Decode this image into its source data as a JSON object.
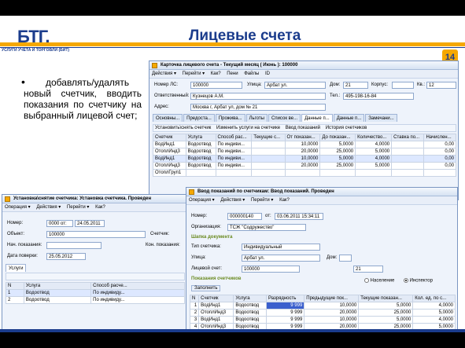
{
  "slide": {
    "title": "Лицевые счета",
    "logo_text": "БТГ.",
    "logo_caption": "УСЛУГИ УЧЕТА И ТОРГОВЛИ (БИТ)",
    "page_number": "14",
    "bullet_text": "добавлять/удалять новый счетчик, вводить показания по счетчику на выбранный лицевой счет;"
  },
  "win1": {
    "title": "Карточка лицевого счета - Текущий месяц ( Июнь ): 100000",
    "toolbar": [
      "Действия ▾",
      "Перейти ▾",
      "Как?",
      "Пени",
      "Файлы",
      "ID"
    ],
    "fields": {
      "nomer_label": "Номер ЛС:",
      "nomer_value": "100000",
      "street_label": "Улица:",
      "street_value": "Арбат ул.",
      "house_label": "Дом:",
      "house_value": "21",
      "korpus_label": "Корпус:",
      "kv_label": "Кв.:",
      "kv_value": "12",
      "otv_label": "Ответственный:",
      "otv_value": "Кузнецов А.М.",
      "tel_label": "Тел.:",
      "tel_value": "495-198-16-84",
      "addr_label": "Адрес:",
      "addr_value": "Москва г, Арбат ул, дом № 21"
    },
    "tabs": [
      "Основны...",
      "Предоста...",
      "Прожива...",
      "Льготы",
      "Список ве...",
      "Данные п...",
      "Данные п...",
      "Замечани..."
    ],
    "subtoolbar": [
      "Установить\\снять счетчик",
      "Изменить услуги на счетчике",
      "Ввод показаний",
      "История счетчиков"
    ],
    "columns": [
      "Счетчик",
      "Услуга",
      "Способ рас...",
      "Текущие с...",
      "От показан...",
      "До показан...",
      "Количество...",
      "Ставка по...",
      "Начислен..."
    ],
    "rows": [
      [
        "ВодИнд1",
        "Водоотвод",
        "По индиви...",
        "",
        "10,0000",
        "5,0000",
        "4,0000",
        "",
        "0,00"
      ],
      [
        "ОтоплИнд3",
        "Водоотвод",
        "По индиви...",
        "",
        "20,0000",
        "25,0000",
        "5,0000",
        "",
        "0,00"
      ],
      [
        "ВодИнд1",
        "Водоотвод",
        "По индиви...",
        "",
        "10,0000",
        "5,0000",
        "4,0000",
        "",
        "0,00"
      ],
      [
        "ОтоплИнд3",
        "Водоотвод",
        "По индиви...",
        "",
        "20,0000",
        "25,0000",
        "5,0000",
        "",
        "0,00"
      ],
      [
        "ОтоплГруп1",
        "",
        "",
        "",
        "",
        "",
        "",
        "",
        ""
      ]
    ]
  },
  "win2": {
    "title": "Установка\\снятие счетчика: Установка счетчика. Проведен",
    "toolbar": [
      "Операция ▾",
      "Действия ▾",
      "Перейти ▾",
      "Как?"
    ],
    "fields": {
      "nomer_label": "Номер:",
      "nomer_value": "0000 от:",
      "date_value": "24.05.2011",
      "object_label": "Объект:",
      "object_value": "100000",
      "schetchik_label": "Счетчик:",
      "nach_label": "Нач. показания:",
      "kon_label": "Кон. показания:",
      "poverka_label": "Дата поверки:",
      "poverka_value": "25.05.2012"
    },
    "tab": "Услуги",
    "columns": [
      "N",
      "Услуга",
      "Способ расче..."
    ],
    "rows": [
      [
        "1",
        "Водоотвод",
        "По индивиду..."
      ],
      [
        "2",
        "Водоотвод",
        "По индивиду..."
      ]
    ]
  },
  "win3": {
    "title": "Ввод показаний по счетчикам: Ввод показаний. Проведен",
    "toolbar": [
      "Операция ▾",
      "Действия ▾",
      "Перейти ▾",
      "Как?"
    ],
    "fields": {
      "nomer_label": "Номер:",
      "nomer_value": "000000140",
      "ot_label": "от:",
      "date_value": "03.06.2011 15:34:11",
      "org_label": "Организация:",
      "org_value": "ТСЖ \"Содружество\""
    },
    "section1": "Шапка документа",
    "fields2": {
      "tip_label": "Тип счетчика:",
      "tip_value": "Индивидуальный",
      "street_label": "Улица:",
      "street_value": "Арбат ул.",
      "dom_label": "Дом:",
      "dom_value": "21",
      "ls_label": "Лицевой счет:",
      "ls_value": "100000",
      "naselenie_label": "Население",
      "inspektor_label": "Инспектор"
    },
    "section2": "Показания счетчиков",
    "fill_button": "Заполнить",
    "columns": [
      "N",
      "Счетчик",
      "Услуга",
      "Разрядность",
      "Предыдущие пок...",
      "Текущие показан...",
      "Кол. ед. по с..."
    ],
    "rows": [
      [
        "1",
        "ВодИнд1",
        "Водоотвод",
        "9 999",
        "10,0000",
        "5,0000",
        "4,0000"
      ],
      [
        "2",
        "ОтоплИнд3",
        "Водоотвод",
        "9 999",
        "20,0000",
        "25,0000",
        "5,0000"
      ],
      [
        "3",
        "ВодИнд1",
        "Водоотвод",
        "9 999",
        "10,0000",
        "5,0000",
        "4,0000"
      ],
      [
        "4",
        "ОтоплИнд3",
        "Водоотвод",
        "9 999",
        "20,0000",
        "25,0000",
        "5,0000"
      ]
    ]
  },
  "colors": {
    "brand_blue": "#1b3c8c",
    "brand_orange": "#f5a800",
    "selection_blue": "#3a5fcd"
  }
}
